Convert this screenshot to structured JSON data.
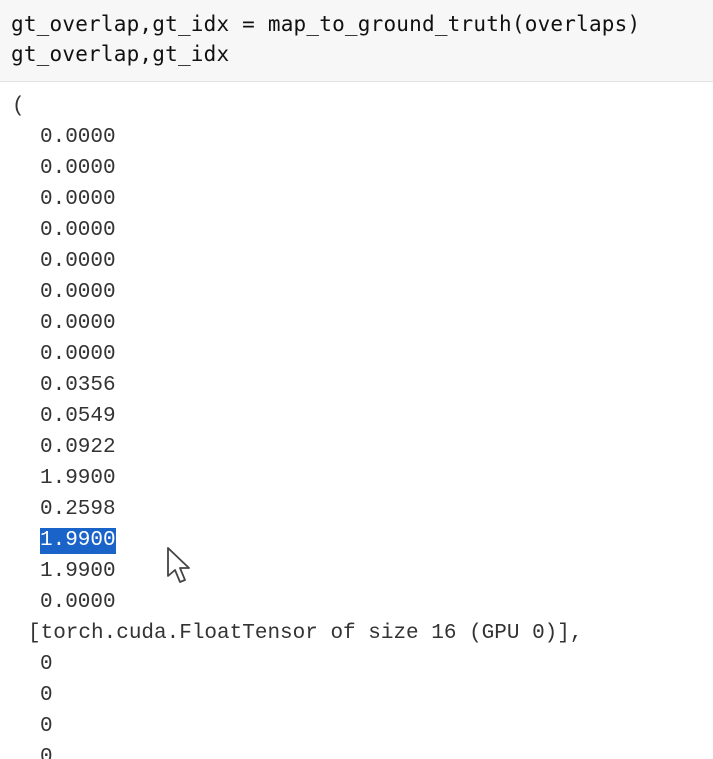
{
  "code": {
    "line1": "gt_overlap,gt_idx = map_to_ground_truth(overlaps)",
    "line2": "gt_overlap,gt_idx"
  },
  "output": {
    "open_paren": "(",
    "values": [
      "0.0000",
      "0.0000",
      "0.0000",
      "0.0000",
      "0.0000",
      "0.0000",
      "0.0000",
      "0.0000",
      "0.0356",
      "0.0549",
      "0.0922",
      "1.9900",
      "0.2598",
      "1.9900",
      "1.9900",
      "0.0000"
    ],
    "selected_index": 13,
    "tensor_info": "[torch.cuda.FloatTensor of size 16 (GPU 0)],",
    "idx_values": [
      "0",
      "0",
      "0",
      "0"
    ]
  },
  "colors": {
    "selection": "#1a63c9",
    "code_bg": "#f7f7f7"
  }
}
